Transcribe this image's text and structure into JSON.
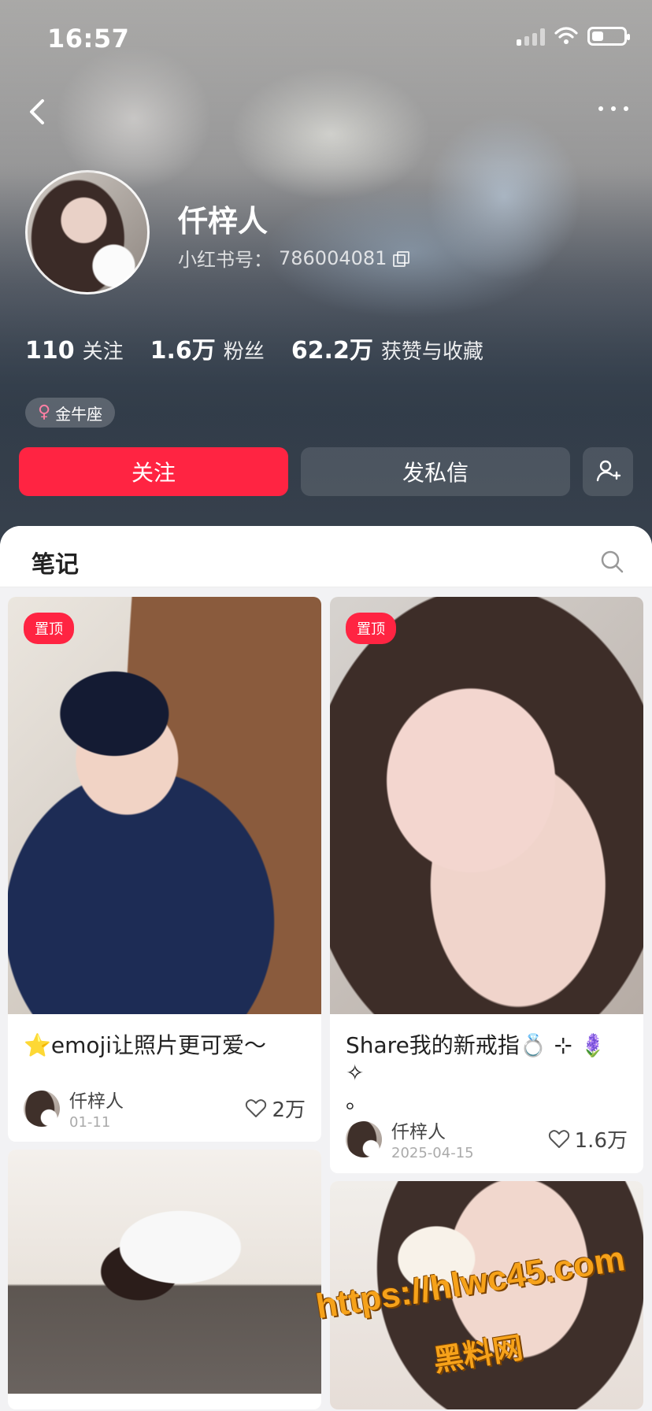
{
  "status_bar": {
    "time": "16:57",
    "signal_icon": "cellular-signal-icon",
    "wifi_icon": "wifi-icon",
    "battery_icon": "battery-icon"
  },
  "navigation": {
    "back_icon": "back-icon",
    "more_icon": "more-icon"
  },
  "profile": {
    "name": "仟梓人",
    "id_label": "小红书号：",
    "id_value": "786004081",
    "copy_icon": "copy-icon",
    "stats": [
      {
        "value": "110",
        "label": "关注"
      },
      {
        "value": "1.6万",
        "label": "粉丝"
      },
      {
        "value": "62.2万",
        "label": "获赞与收藏"
      }
    ],
    "tag": "金牛座",
    "tag_icon": "female-icon"
  },
  "actions": {
    "follow": "关注",
    "message": "发私信",
    "add_friend_icon": "add-user-icon",
    "follow_color": "#ff2442"
  },
  "notes_tab": {
    "label": "笔记",
    "search_icon": "search-icon"
  },
  "posts": [
    {
      "badge": "置顶",
      "title": "⭐emoji让照片更可爱～",
      "author": "仟梓人",
      "date": "01-11",
      "likes": "2万"
    },
    {
      "badge": "置顶",
      "title_line1": "Share我的新戒指💍 ⊹ 🪻 ✧",
      "title_line2": "。",
      "author": "仟梓人",
      "date": "2025-04-15",
      "likes": "1.6万"
    }
  ],
  "watermark": {
    "line1": "https://hlwc45.com",
    "line2": "黑料网"
  }
}
